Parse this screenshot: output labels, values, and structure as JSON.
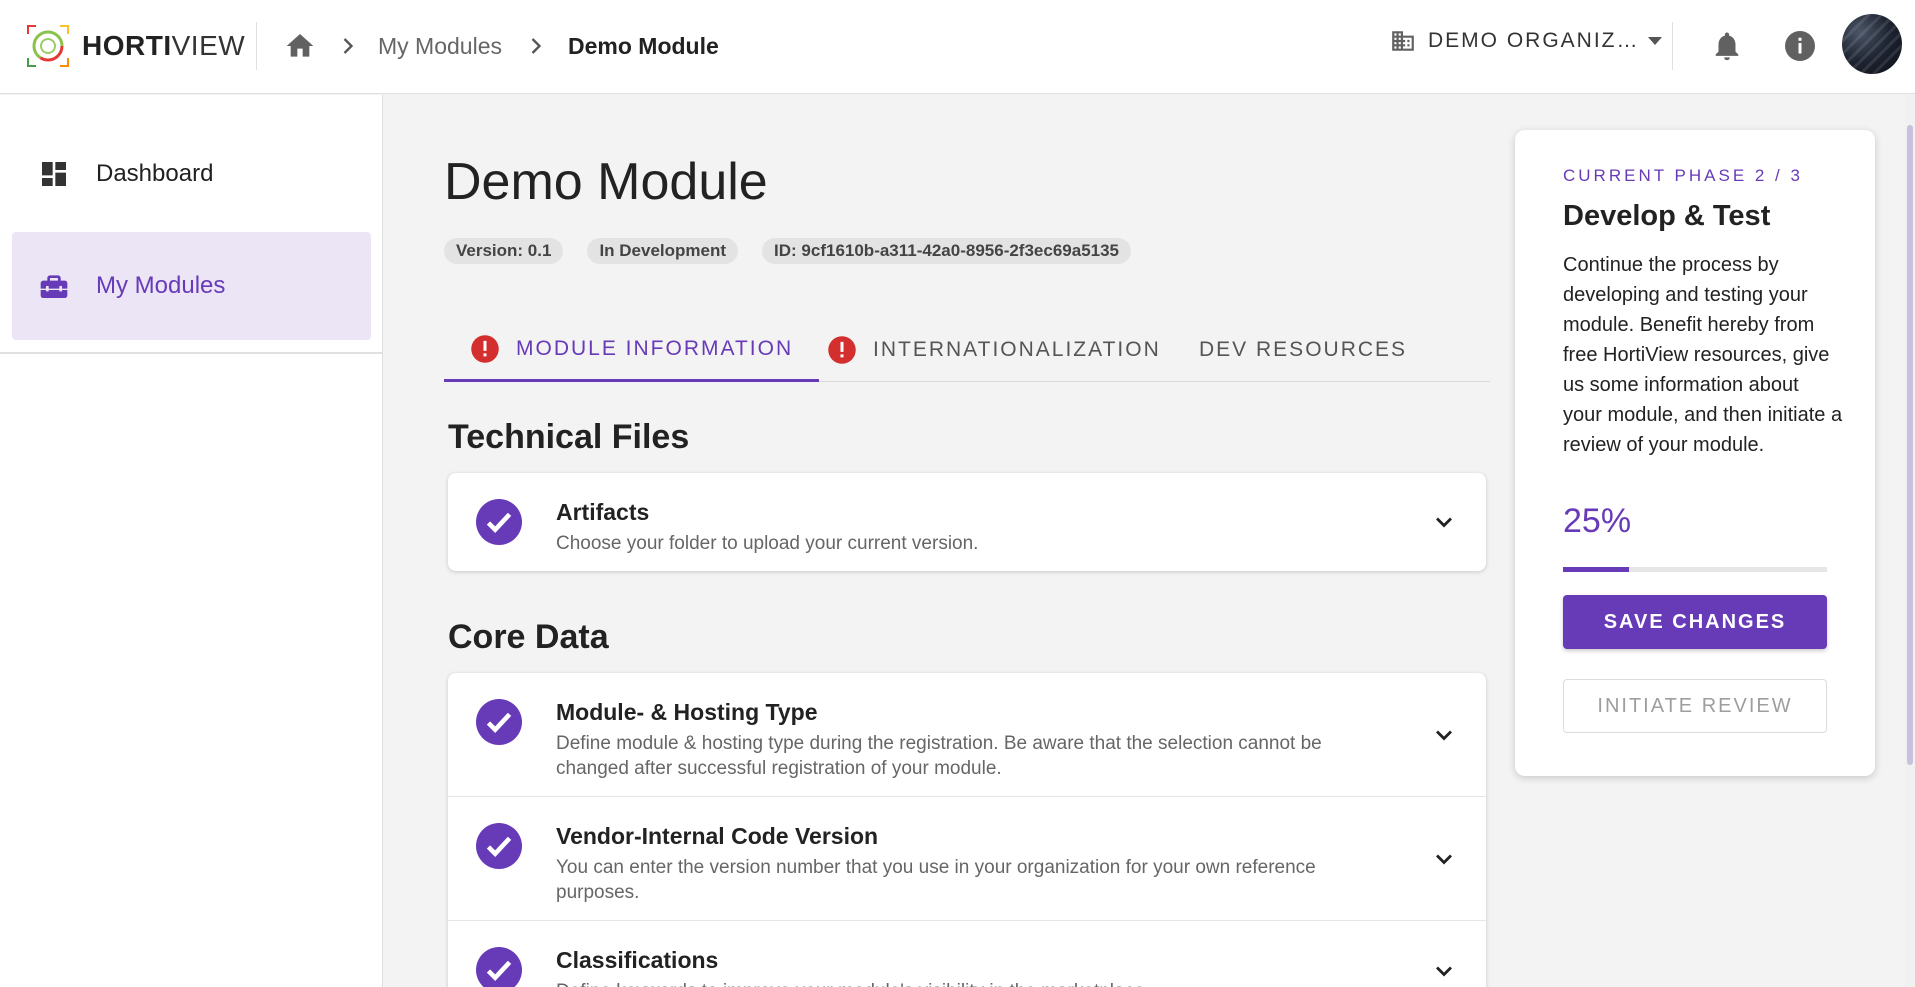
{
  "header": {
    "logo_bold": "HORTI",
    "logo_light": "VIEW",
    "breadcrumb": [
      {
        "label": "My Modules"
      },
      {
        "label": "Demo Module"
      }
    ],
    "organization": "DEMO ORGANIZ…"
  },
  "sidebar": {
    "items": [
      {
        "label": "Dashboard",
        "icon": "dashboard-icon"
      },
      {
        "label": "My Modules",
        "icon": "toolbox-icon",
        "active": true
      }
    ]
  },
  "main": {
    "title": "Demo Module",
    "chips": {
      "version": "Version: 0.1",
      "status": "In Development",
      "id": "ID: 9cf1610b-a311-42a0-8956-2f3ec69a5135"
    },
    "tabs": [
      {
        "label": "MODULE INFORMATION",
        "warning": true,
        "active": true
      },
      {
        "label": "INTERNATIONALIZATION",
        "warning": true
      },
      {
        "label": "DEV RESOURCES",
        "warning": false
      }
    ],
    "sections": [
      {
        "title": "Technical Files",
        "rows": [
          {
            "title": "Artifacts",
            "desc": "Choose your folder to upload your current version."
          }
        ]
      },
      {
        "title": "Core Data",
        "rows": [
          {
            "title": "Module- & Hosting Type",
            "desc": "Define module & hosting type during the registration. Be aware that the selection cannot be changed after successful registration of your module."
          },
          {
            "title": "Vendor-Internal Code Version",
            "desc": "You can enter the version number that you use in your organization for your own reference purposes."
          },
          {
            "title": "Classifications",
            "desc": "Define keywords to improve your module's visibility in the marketplace."
          }
        ]
      }
    ]
  },
  "phase": {
    "label": "CURRENT PHASE 2 / 3",
    "title": "Develop & Test",
    "desc": "Continue the process by developing and testing your module. Benefit hereby from free HortiView resources, give us some information about your module, and then initiate a review of your module.",
    "percent_label": "25%",
    "progress": 0.25,
    "save_label": "SAVE CHANGES",
    "review_label": "INITIATE REVIEW"
  },
  "colors": {
    "accent": "#673ab7",
    "warning": "#d32f2f",
    "active_bg": "#ebe5f5"
  }
}
